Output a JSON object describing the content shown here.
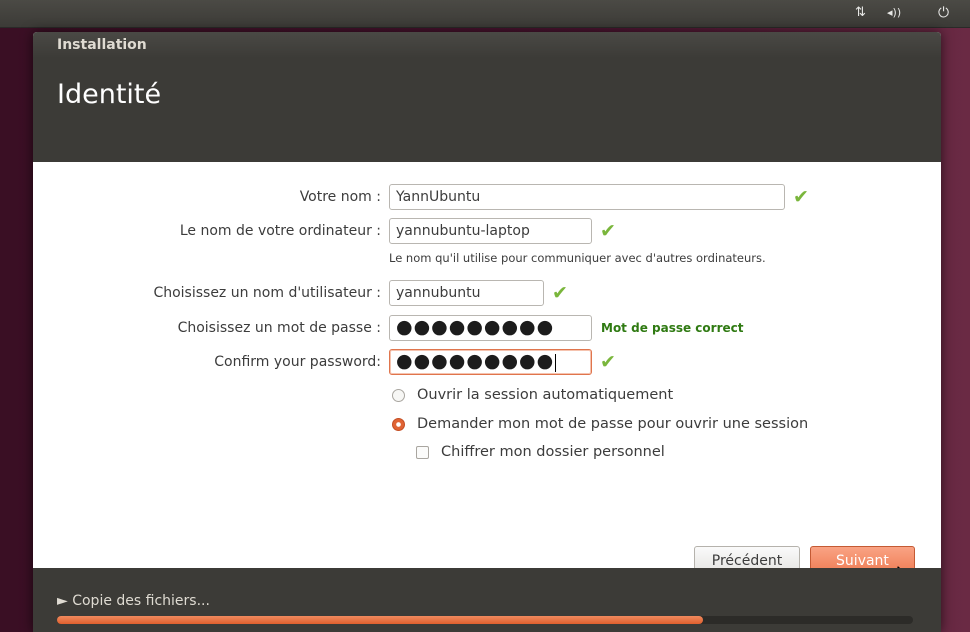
{
  "panel": {
    "network_icon": "⇅",
    "volume_icon": "◂))",
    "power_icon": "⏻"
  },
  "window": {
    "title": "Installation",
    "page_title": "Identité"
  },
  "form": {
    "name_label": "Votre nom :",
    "name_value": "YannUbuntu",
    "computer_label": "Le nom de votre ordinateur :",
    "computer_value": "yannubuntu-laptop",
    "computer_hint": "Le nom qu'il utilise pour communiquer avec d'autres ordinateurs.",
    "username_label": "Choisissez un nom d'utilisateur :",
    "username_value": "yannubuntu",
    "password_label": "Choisissez un mot de passe :",
    "password_value": "●●●●●●●●●",
    "password_status": "Mot de passe correct",
    "confirm_label": "Confirm your password:",
    "confirm_value": "●●●●●●●●●",
    "check_mark": "✔"
  },
  "options": {
    "auto_login_label": "Ouvrir la session automatiquement",
    "auto_login_selected": false,
    "ask_password_label": "Demander mon mot de passe pour ouvrir une session",
    "ask_password_selected": true,
    "encrypt_home_label": "Chiffrer mon dossier personnel",
    "encrypt_home_checked": false
  },
  "buttons": {
    "previous_label": "Précédent",
    "next_label": "Suivant"
  },
  "progress": {
    "label": "► Copie des fichiers...",
    "fraction": 0.755
  },
  "colors": {
    "accent": "#e0602e",
    "check": "#7ab63c",
    "status_ok": "#2f7a12"
  }
}
